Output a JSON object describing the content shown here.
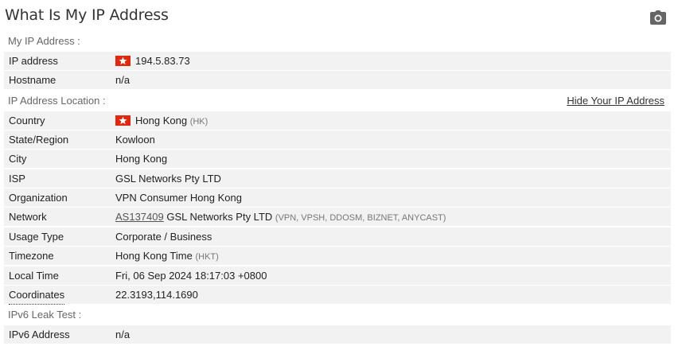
{
  "page_title": "What Is My IP Address",
  "sections": {
    "my_ip": "My IP Address :",
    "location": "IP Address Location :",
    "hide_link": "Hide Your IP Address",
    "ipv6": "IPv6 Leak Test :"
  },
  "rows": {
    "ip_address": {
      "label": "IP address",
      "value": "194.5.83.73"
    },
    "hostname": {
      "label": "Hostname",
      "value": "n/a"
    },
    "country": {
      "label": "Country",
      "value": "Hong Kong",
      "code": "(HK)"
    },
    "state": {
      "label": "State/Region",
      "value": "Kowloon"
    },
    "city": {
      "label": "City",
      "value": "Hong Kong"
    },
    "isp": {
      "label": "ISP",
      "value": "GSL Networks Pty LTD"
    },
    "organization": {
      "label": "Organization",
      "value": "VPN Consumer Hong Kong"
    },
    "network": {
      "label": "Network",
      "asn": "AS137409",
      "value": "GSL Networks Pty LTD",
      "tags": "(VPN, VPSH, DDOSM, BIZNET, ANYCAST)"
    },
    "usage_type": {
      "label": "Usage Type",
      "value": "Corporate / Business"
    },
    "timezone": {
      "label": "Timezone",
      "value": "Hong Kong Time",
      "abbr": "(HKT)"
    },
    "local_time": {
      "label": "Local Time",
      "value": "Fri, 06 Sep 2024 18:17:03 +0800"
    },
    "coordinates": {
      "label": "Coordinates",
      "value": "22.3193,114.1690"
    },
    "ipv6_address": {
      "label": "IPv6 Address",
      "value": "n/a"
    }
  },
  "icons": {
    "camera": "camera-icon",
    "flag": "hong-kong-flag-icon"
  },
  "colors": {
    "row_bg": "#f2f2f2",
    "flag_red": "#de2910"
  }
}
